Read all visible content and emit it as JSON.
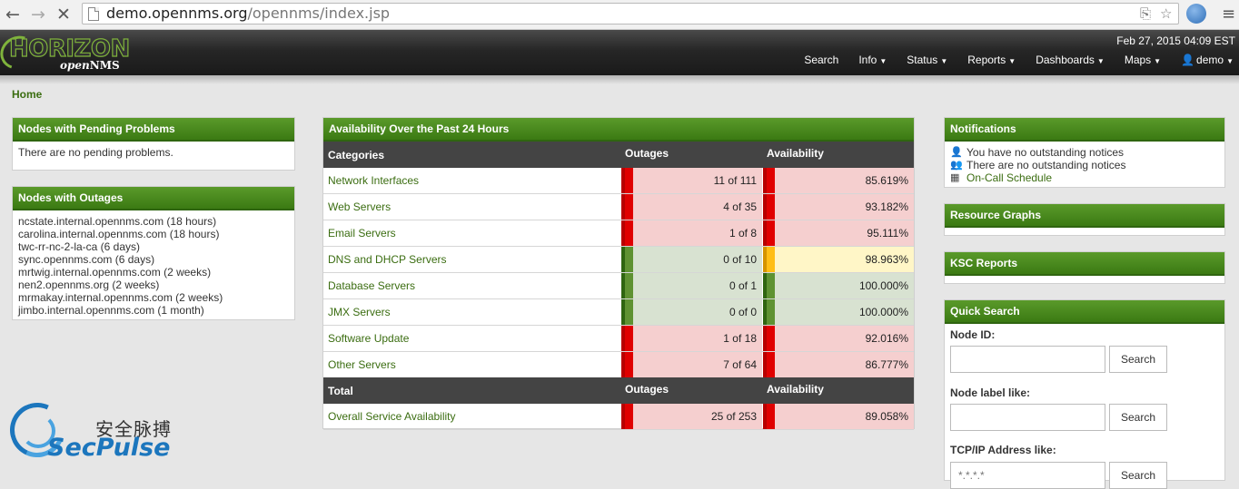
{
  "browser": {
    "url_domain": "demo.opennms.org",
    "url_path": "/opennms/index.jsp"
  },
  "header": {
    "logo_main": "HORIZON",
    "logo_sub_open": "open",
    "logo_sub_nms": "NMS",
    "timestamp": "Feb 27, 2015 04:09 EST",
    "nav": {
      "search": "Search",
      "info": "Info",
      "status": "Status",
      "reports": "Reports",
      "dashboards": "Dashboards",
      "maps": "Maps",
      "user": "demo"
    }
  },
  "breadcrumb": "Home",
  "pending": {
    "title": "Nodes with Pending Problems",
    "message": "There are no pending problems."
  },
  "outages": {
    "title": "Nodes with Outages",
    "items": [
      {
        "node": "ncstate.internal.opennms.com",
        "duration": " (18 hours)"
      },
      {
        "node": "carolina.internal.opennms.com",
        "duration": " (18 hours)"
      },
      {
        "node": "twc-rr-nc-2-la-ca",
        "duration": " (6 days)"
      },
      {
        "node": "sync.opennms.com",
        "duration": " (6 days)"
      },
      {
        "node": "mrtwig.internal.opennms.com",
        "duration": " (2 weeks)"
      },
      {
        "node": "nen2.opennms.org",
        "duration": " (2 weeks)"
      },
      {
        "node": "mrmakay.internal.opennms.com",
        "duration": " (2 weeks)"
      },
      {
        "node": "jimbo.internal.opennms.com",
        "duration": " (1 month)"
      }
    ]
  },
  "availability": {
    "title": "Availability Over the Past 24 Hours",
    "headers": {
      "categories": "Categories",
      "outages": "Outages",
      "availability": "Availability"
    },
    "rows": [
      {
        "category": "Network Interfaces",
        "outages": "11 of 111",
        "availability": "85.619%",
        "status": "red"
      },
      {
        "category": "Web Servers",
        "outages": "4 of 35",
        "availability": "93.182%",
        "status": "red"
      },
      {
        "category": "Email Servers",
        "outages": "1 of 8",
        "availability": "95.111%",
        "status": "red"
      },
      {
        "category": "DNS and DHCP Servers",
        "outages": "0 of 10",
        "availability": "98.963%",
        "status": "green",
        "avail_status": "yellow"
      },
      {
        "category": "Database Servers",
        "outages": "0 of 1",
        "availability": "100.000%",
        "status": "green"
      },
      {
        "category": "JMX Servers",
        "outages": "0 of 0",
        "availability": "100.000%",
        "status": "green"
      },
      {
        "category": "Software Update",
        "outages": "1 of 18",
        "availability": "92.016%",
        "status": "red"
      },
      {
        "category": "Other Servers",
        "outages": "7 of 64",
        "availability": "86.777%",
        "status": "red"
      }
    ],
    "total_headers": {
      "total": "Total",
      "outages": "Outages",
      "availability": "Availability"
    },
    "total_row": {
      "category": "Overall Service Availability",
      "outages": "25 of 253",
      "availability": "89.058%",
      "status": "red"
    }
  },
  "notifications": {
    "title": "Notifications",
    "line1": "You have no outstanding notices",
    "line2": "There are no outstanding notices",
    "line3": "On-Call Schedule"
  },
  "resource_graphs": {
    "title": "Resource Graphs"
  },
  "ksc_reports": {
    "title": "KSC Reports"
  },
  "quick_search": {
    "title": "Quick Search",
    "node_id_label": "Node ID:",
    "node_label_label": "Node label like:",
    "tcpip_label": "TCP/IP Address like:",
    "tcpip_placeholder": "*.*.*.*",
    "button": "Search"
  },
  "watermark": {
    "cn": "安全脉搏",
    "en": "SecPulse"
  },
  "colors": {
    "brand_green": "#3b7a13",
    "header_dark": "#262626",
    "outage_red": "#e00000",
    "ok_green": "#5f9232",
    "warn_yellow": "#ffbe16"
  }
}
